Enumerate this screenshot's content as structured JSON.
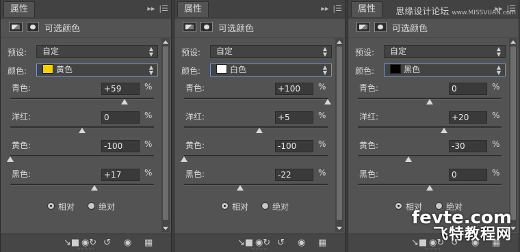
{
  "panels": [
    {
      "tab": "属性",
      "adj_title": "可选颜色",
      "preset_label": "预设:",
      "preset_value": "自定",
      "color_label": "颜色:",
      "color_value": "黄色",
      "color_swatch": "#f2d200",
      "sliders": [
        {
          "label": "青色:",
          "value": "+59",
          "level": 0.795
        },
        {
          "label": "洋红:",
          "value": "0",
          "level": 0.5
        },
        {
          "label": "黄色:",
          "value": "-100",
          "level": 0.0
        },
        {
          "label": "黑色:",
          "value": "+17",
          "level": 0.585
        }
      ],
      "pct": "%",
      "radio_relative": "相对",
      "radio_absolute": "绝对",
      "relative_selected": true
    },
    {
      "tab": "属性",
      "adj_title": "可选颜色",
      "preset_label": "预设:",
      "preset_value": "自定",
      "color_label": "颜色:",
      "color_value": "白色",
      "color_swatch": "#ffffff",
      "sliders": [
        {
          "label": "青色:",
          "value": "+100",
          "level": 1.0
        },
        {
          "label": "洋红:",
          "value": "+5",
          "level": 0.525
        },
        {
          "label": "黄色:",
          "value": "-100",
          "level": 0.0
        },
        {
          "label": "黑色:",
          "value": "-22",
          "level": 0.39
        }
      ],
      "pct": "%",
      "radio_relative": "相对",
      "radio_absolute": "绝对",
      "relative_selected": true
    },
    {
      "tab": "属性",
      "adj_title": "可选颜色",
      "preset_label": "预设:",
      "preset_value": "自定",
      "color_label": "颜色:",
      "color_value": "黑色",
      "color_swatch": "#000000",
      "sliders": [
        {
          "label": "青色:",
          "value": "0",
          "level": 0.5
        },
        {
          "label": "洋红:",
          "value": "+20",
          "level": 0.6
        },
        {
          "label": "黄色:",
          "value": "-30",
          "level": 0.35
        },
        {
          "label": "黑色:",
          "value": "0",
          "level": 0.5
        }
      ],
      "pct": "%",
      "radio_relative": "相对",
      "radio_absolute": "绝对",
      "relative_selected": true
    }
  ],
  "icons": {
    "collapse": "double-arrow-right-icon",
    "menu": "panel-menu-icon",
    "clip": "clip-to-layer-icon",
    "view_prev": "view-previous-icon",
    "reset": "reset-icon",
    "visibility": "eye-icon",
    "delete": "trash-icon"
  },
  "watermark_top": "思缘设计论坛",
  "watermark_top_small": "www.MISSVUAN.com",
  "watermark_brand": "fevte.com",
  "watermark_brand_cn": "飞特教程网"
}
